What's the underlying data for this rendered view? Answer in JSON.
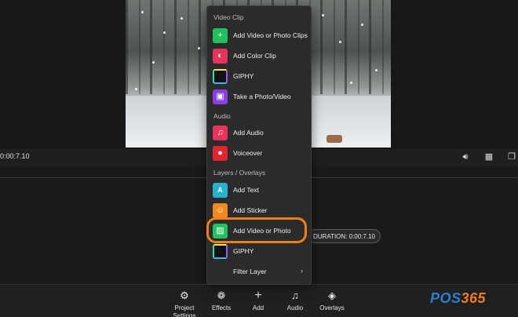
{
  "timecode": "0:00:7.10",
  "duration": "DURATION: 0:00:7.10",
  "menu": {
    "sections": [
      "Video Clip",
      "Audio",
      "Layers / Overlays"
    ],
    "items": [
      {
        "label": "Add Video or Photo Clips",
        "icon": "plus-icon",
        "color": "#21c25e"
      },
      {
        "label": "Add Color Clip",
        "icon": "palette-icon",
        "color": "#e8325e"
      },
      {
        "label": "GIPHY",
        "icon": "giphy-icon",
        "color": "#111111"
      },
      {
        "label": "Take a Photo/Video",
        "icon": "camera-icon",
        "color": "#8a3fe3"
      },
      {
        "label": "Add Audio",
        "icon": "music-note-icon",
        "color": "#e8325e"
      },
      {
        "label": "Voiceover",
        "icon": "microphone-icon",
        "color": "#e2242f"
      },
      {
        "label": "Add Text",
        "icon": "text-icon",
        "color": "#27b3cf"
      },
      {
        "label": "Add Sticker",
        "icon": "smiley-icon",
        "color": "#f08a1e"
      },
      {
        "label": "Add Video or Photo",
        "icon": "image-icon",
        "color": "#21c25e"
      },
      {
        "label": "GIPHY",
        "icon": "giphy-icon",
        "color": "#111111"
      },
      {
        "label": "Filter Layer",
        "icon": "none",
        "color": "#2b2b2b"
      }
    ]
  },
  "toolbar": {
    "project_settings": "Project Settings",
    "effects": "Effects",
    "add": "Add",
    "audio": "Audio",
    "overlays": "Overlays"
  },
  "brand": {
    "prefix": "POS",
    "suffix": "365"
  },
  "colors": {
    "highlight": "#f07e1b",
    "brand_blue": "#2b7fd0"
  }
}
